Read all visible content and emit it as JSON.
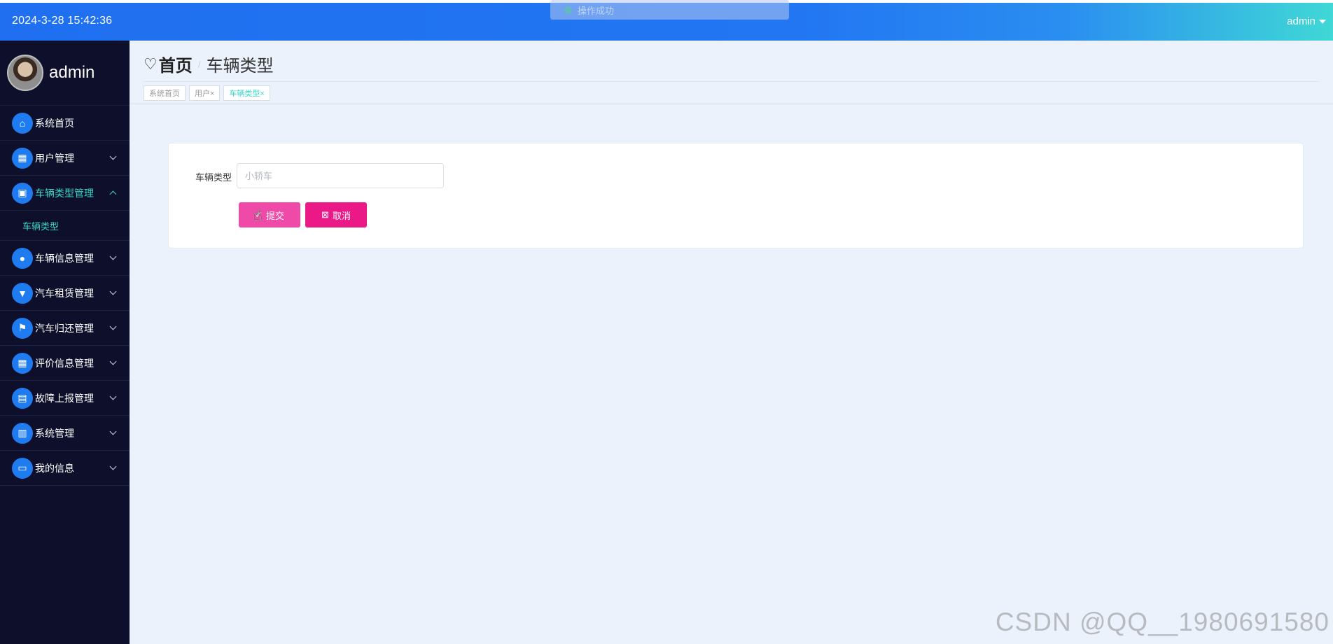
{
  "header": {
    "datetime": "2024-3-28 15:42:36",
    "user_label": "admin",
    "toast_text": "操作成功"
  },
  "sidebar": {
    "profile_name": "admin",
    "items": [
      {
        "label": "系统首页",
        "icon": "home-icon"
      },
      {
        "label": "用户管理",
        "icon": "grid-icon"
      },
      {
        "label": "车辆类型管理",
        "icon": "image-icon",
        "sub": [
          {
            "label": "车辆类型"
          }
        ]
      },
      {
        "label": "车辆信息管理",
        "icon": "pin-icon"
      },
      {
        "label": "汽车租赁管理",
        "icon": "filter-icon"
      },
      {
        "label": "汽车归还管理",
        "icon": "flag-icon"
      },
      {
        "label": "评价信息管理",
        "icon": "grid-icon"
      },
      {
        "label": "故障上报管理",
        "icon": "briefcase-icon"
      },
      {
        "label": "系统管理",
        "icon": "clipboard-icon"
      },
      {
        "label": "我的信息",
        "icon": "card-icon"
      }
    ]
  },
  "breadcrumb": {
    "home": "首页",
    "separator": "/",
    "current": "车辆类型"
  },
  "tags": [
    {
      "label": "系统首页"
    },
    {
      "label": "用户×"
    },
    {
      "label": "车辆类型×"
    }
  ],
  "form": {
    "field_label": "车辆类型",
    "field_placeholder": "小轿车",
    "submit_label": "提交",
    "cancel_label": "取消"
  },
  "watermark": "CSDN @QQ__1980691580",
  "colors": {
    "accent": "#1e7cf0",
    "sidebar_bg": "#0d0f2b",
    "active_text": "#38d6c8",
    "submit": "#ef4aa8",
    "cancel": "#eb1987"
  }
}
